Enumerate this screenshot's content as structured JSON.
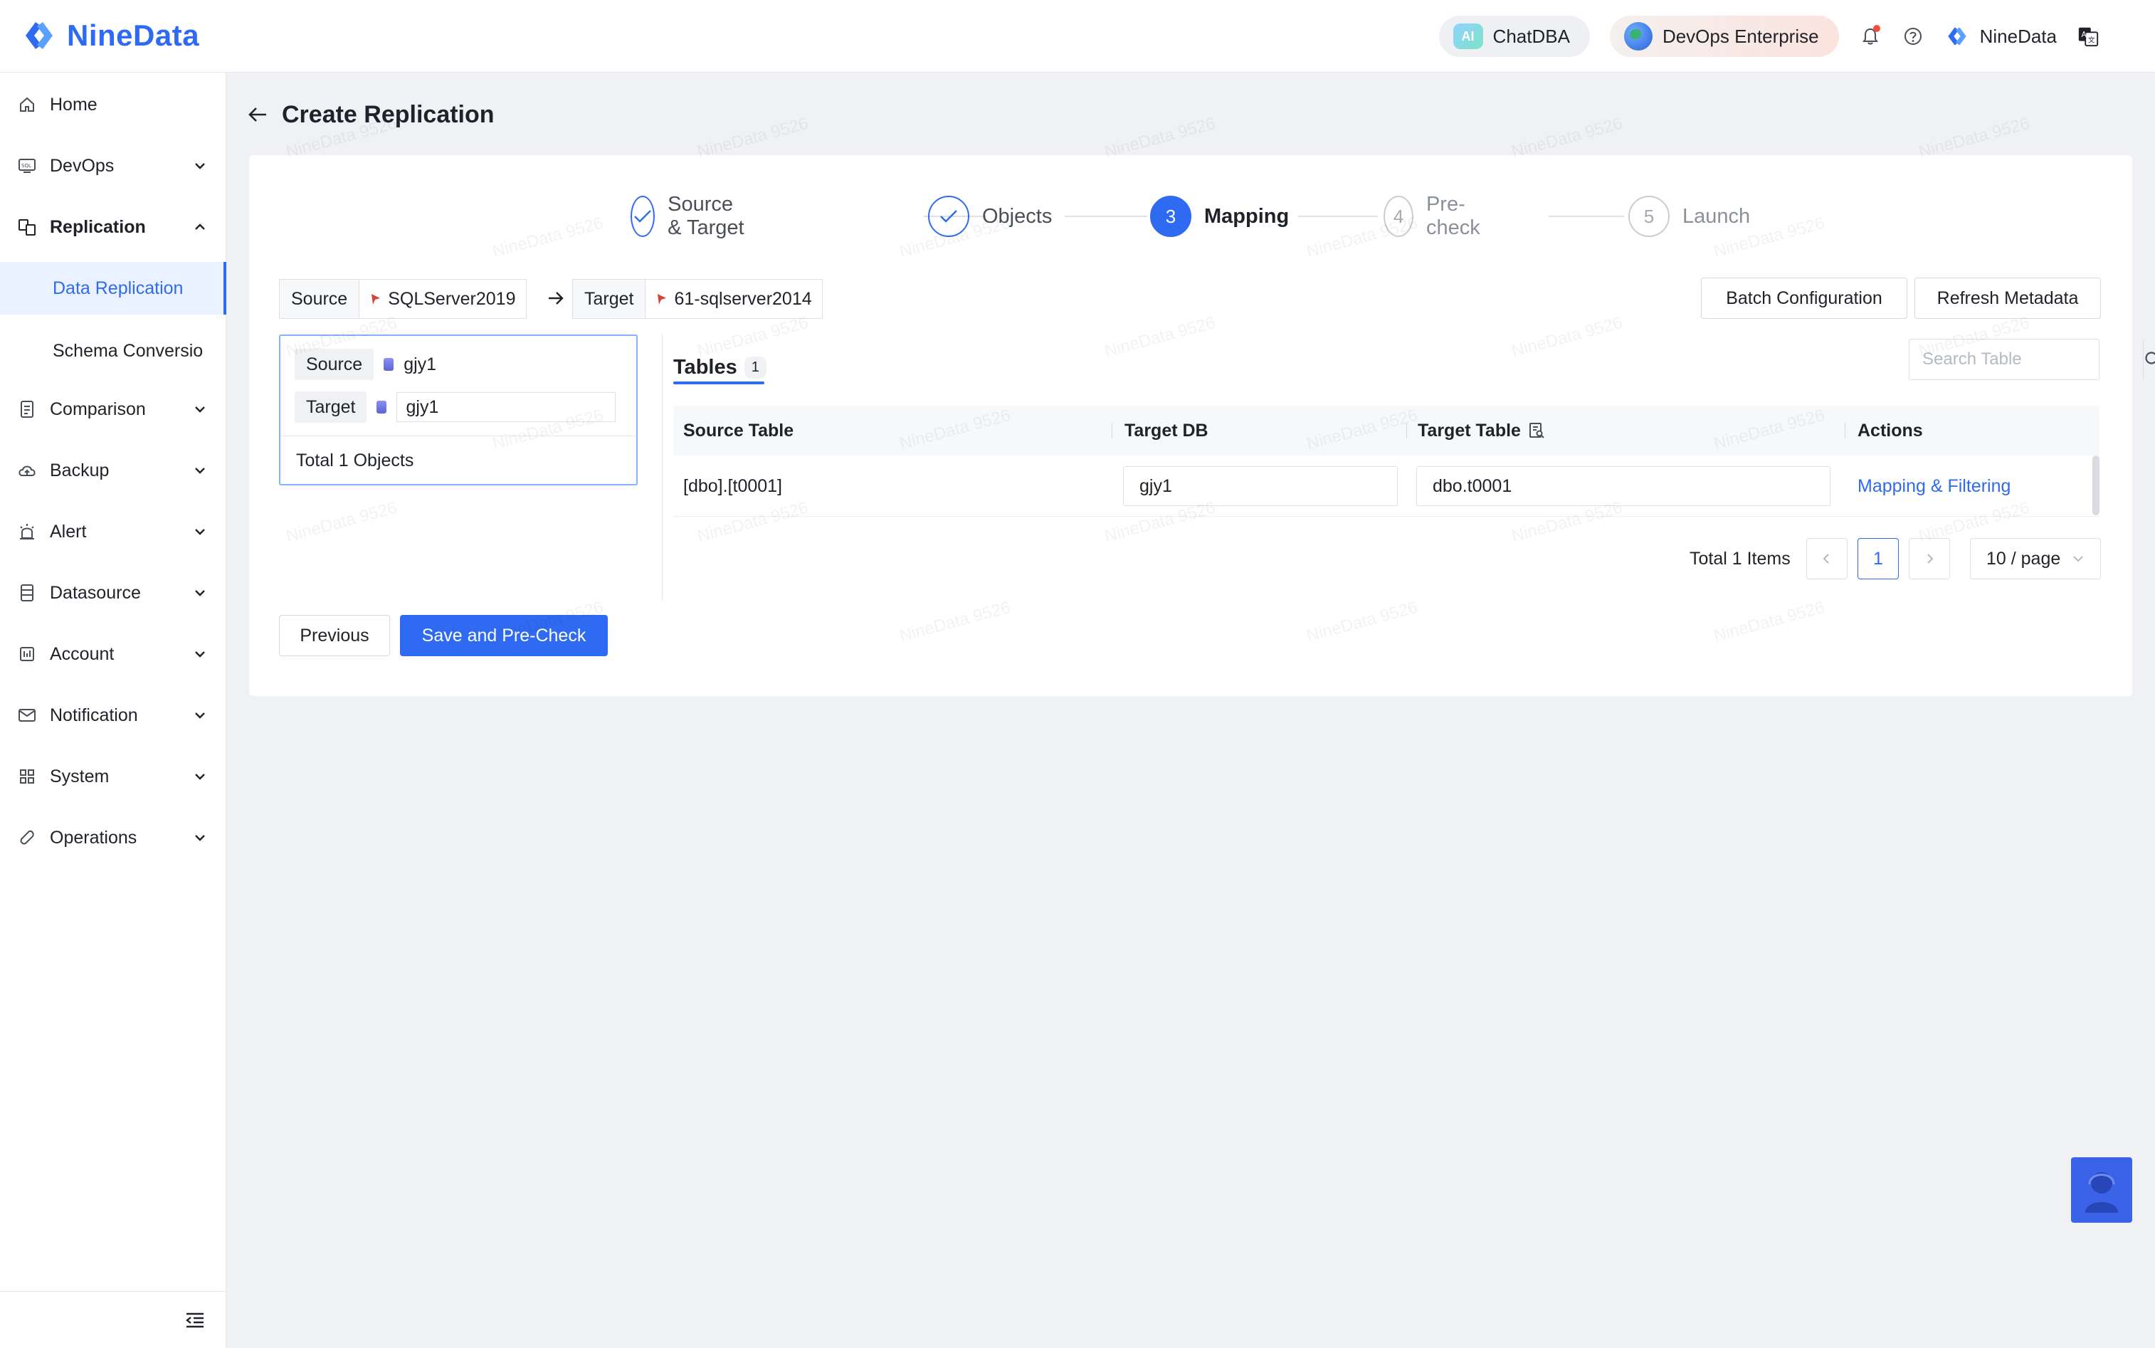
{
  "app": {
    "brand": "NineData",
    "brand_color": "#2f6bf2"
  },
  "topbar": {
    "chatdba": "ChatDBA",
    "ai_badge": "AI",
    "devops": "DevOps Enterprise",
    "user": "NineData"
  },
  "sidebar": {
    "items": [
      {
        "label": "Home",
        "icon": "home-icon"
      },
      {
        "label": "DevOps",
        "icon": "sql-icon"
      },
      {
        "label": "Replication",
        "icon": "replication-icon"
      },
      {
        "label": "Data Replication"
      },
      {
        "label": "Schema Conversio"
      },
      {
        "label": "Comparison",
        "icon": "comparison-icon"
      },
      {
        "label": "Backup",
        "icon": "backup-icon"
      },
      {
        "label": "Alert",
        "icon": "alert-icon"
      },
      {
        "label": "Datasource",
        "icon": "datasource-icon"
      },
      {
        "label": "Account",
        "icon": "account-icon"
      },
      {
        "label": "Notification",
        "icon": "notification-icon"
      },
      {
        "label": "System",
        "icon": "system-icon"
      },
      {
        "label": "Operations",
        "icon": "operations-icon"
      }
    ]
  },
  "page": {
    "title": "Create Replication"
  },
  "steps": [
    {
      "num": "",
      "label": "Source & Target",
      "state": "done"
    },
    {
      "num": "",
      "label": "Objects",
      "state": "done"
    },
    {
      "num": "3",
      "label": "Mapping",
      "state": "active"
    },
    {
      "num": "4",
      "label": "Pre-check",
      "state": "todo"
    },
    {
      "num": "5",
      "label": "Launch",
      "state": "todo"
    }
  ],
  "route": {
    "source_key": "Source",
    "source_val": "SQLServer2019",
    "target_key": "Target",
    "target_val": "61-sqlserver2014"
  },
  "actions": {
    "batch": "Batch Configuration",
    "refresh": "Refresh Metadata",
    "previous": "Previous",
    "save": "Save and Pre-Check"
  },
  "objects": {
    "source_key": "Source",
    "source_db": "gjy1",
    "target_key": "Target",
    "target_db": "gjy1",
    "total": "Total 1 Objects"
  },
  "tables_tab": {
    "label": "Tables",
    "count": "1"
  },
  "search": {
    "placeholder": "Search Table"
  },
  "table": {
    "headers": [
      "Source Table",
      "Target DB",
      "Target Table",
      "Actions"
    ],
    "rows": [
      {
        "source": "[dbo].[t0001]",
        "target_db": "gjy1",
        "target_table": "dbo.t0001",
        "action": "Mapping & Filtering"
      }
    ]
  },
  "pagination": {
    "total": "Total 1 Items",
    "current": "1",
    "page_size": "10 / page"
  },
  "watermark": "NineData 9526"
}
